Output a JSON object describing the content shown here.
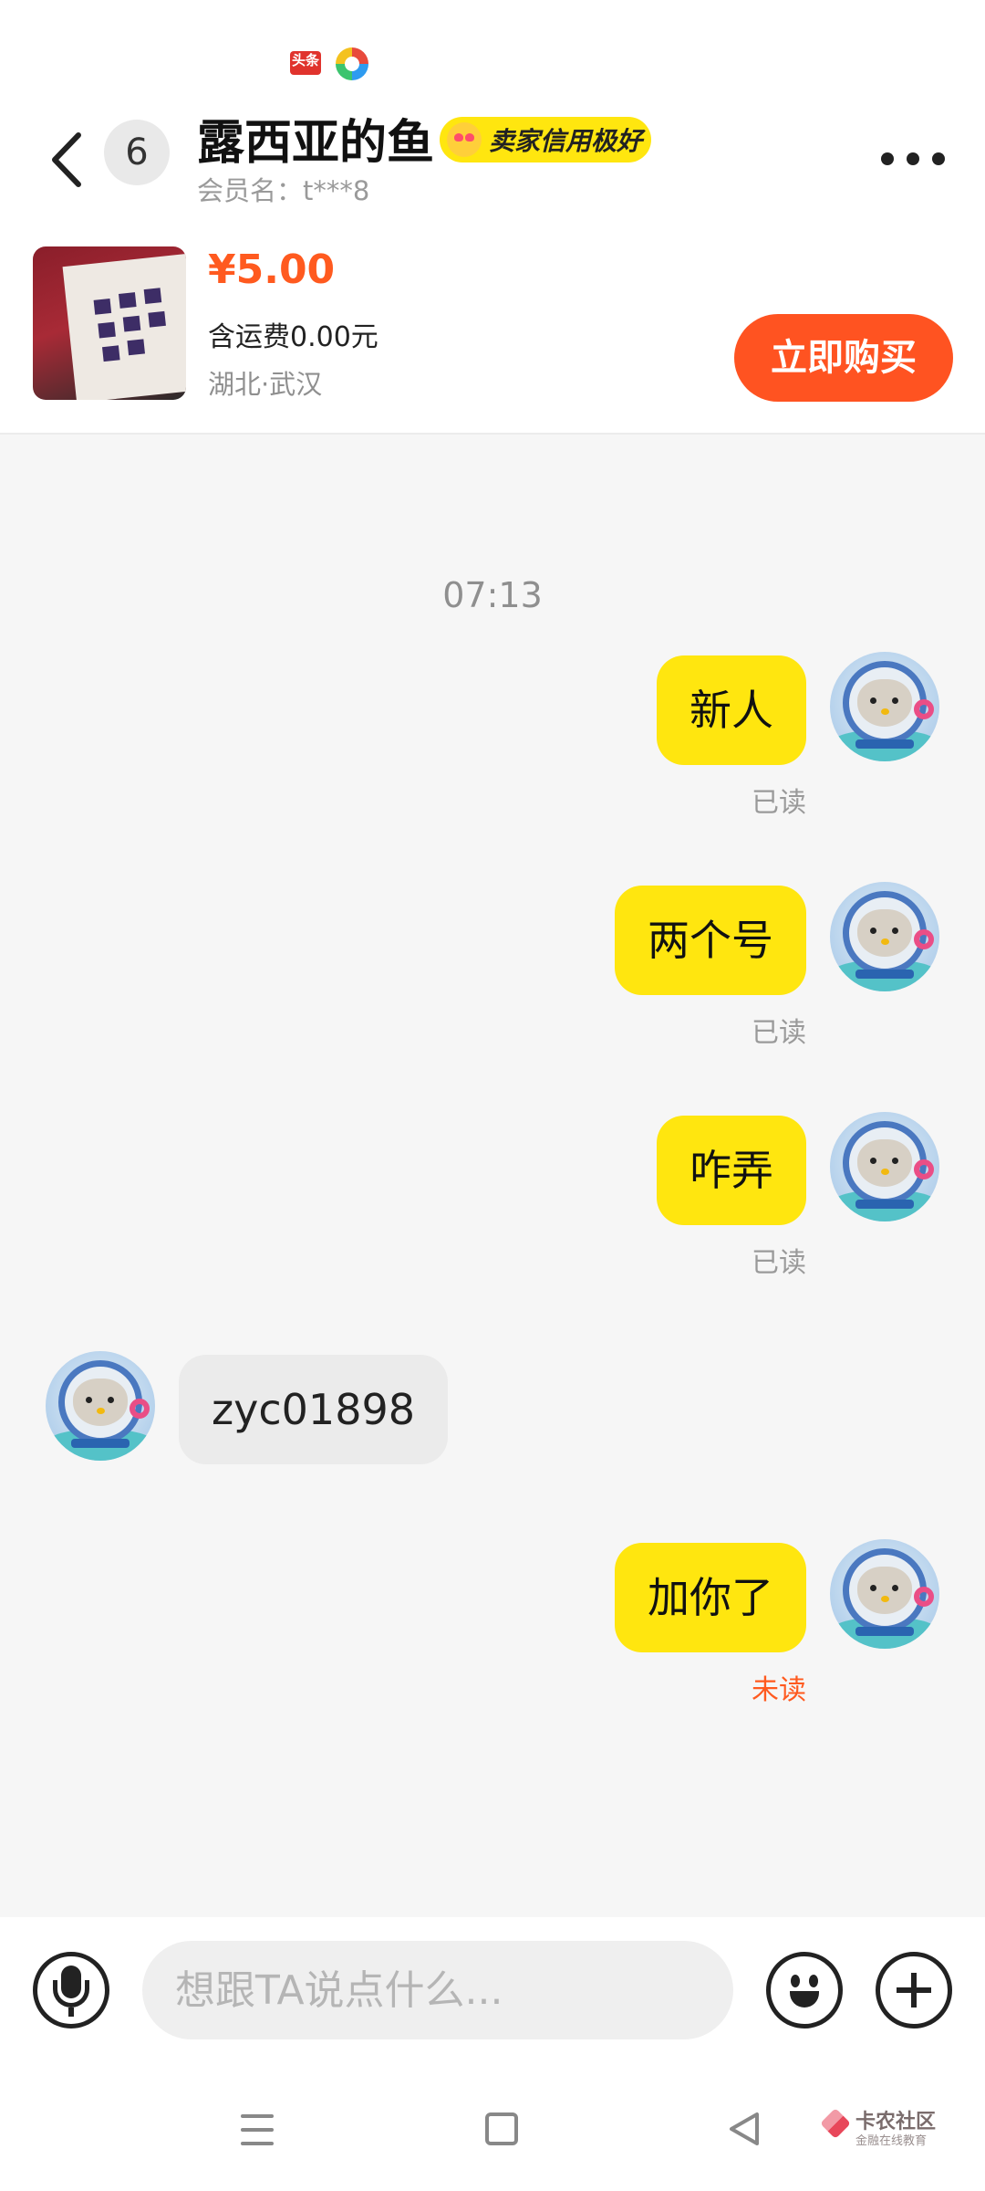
{
  "status_bar": {
    "app_icon_1_label": "头条",
    "icons": [
      "toutiao-icon",
      "color-wheel-icon"
    ]
  },
  "header": {
    "unread_count": "6",
    "seller_name": "露西亚的鱼",
    "credit_badge": "卖家信用极好",
    "member_name": "会员名：t***8"
  },
  "product": {
    "price": "¥5.00",
    "shipping": "含运费0.00元",
    "location": "湖北·武汉",
    "buy_label": "立即购买"
  },
  "chat": {
    "timestamp": "07:13",
    "messages": [
      {
        "text": "新人",
        "from": "me",
        "status": "已读"
      },
      {
        "text": "两个号",
        "from": "me",
        "status": "已读"
      },
      {
        "text": "咋弄",
        "from": "me",
        "status": "已读"
      },
      {
        "text": "zyc01898",
        "from": "them",
        "status": ""
      },
      {
        "text": "加你了",
        "from": "me",
        "status": "未读"
      }
    ]
  },
  "input": {
    "placeholder": "想跟TA说点什么...",
    "value": ""
  },
  "watermark": {
    "title": "卡农社区",
    "subtitle": "金融在线教育"
  },
  "colors": {
    "accent": "#ff5321",
    "price": "#ff5a1f",
    "my_bubble": "#ffe60f",
    "their_bubble": "#ebebeb",
    "unread_status": "#ff5a1f"
  }
}
